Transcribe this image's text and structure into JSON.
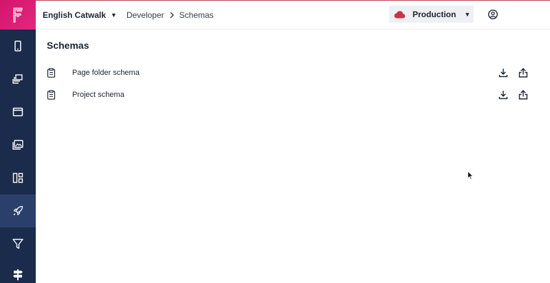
{
  "sidebar": {
    "logo_icon": "frontastic-logo-icon",
    "items": [
      {
        "icon": "mobile-device-icon"
      },
      {
        "icon": "stacked-pages-icon"
      },
      {
        "icon": "window-icon"
      },
      {
        "icon": "image-gallery-icon"
      },
      {
        "icon": "layout-blocks-icon"
      },
      {
        "icon": "rocket-icon",
        "active": true
      },
      {
        "icon": "filter-icon"
      },
      {
        "icon": "signpost-icon"
      }
    ]
  },
  "topbar": {
    "project_name": "English Catwalk",
    "breadcrumb": [
      "Developer",
      "Schemas"
    ],
    "environment": "Production",
    "environment_color": "#c8324a"
  },
  "main": {
    "title": "Schemas",
    "schemas": [
      {
        "name": "Page folder schema"
      },
      {
        "name": "Project schema"
      }
    ]
  },
  "colors": {
    "sidebar": "#1a2b4b",
    "logo": "#d4146c",
    "active_nav": "#2a3f6a"
  }
}
